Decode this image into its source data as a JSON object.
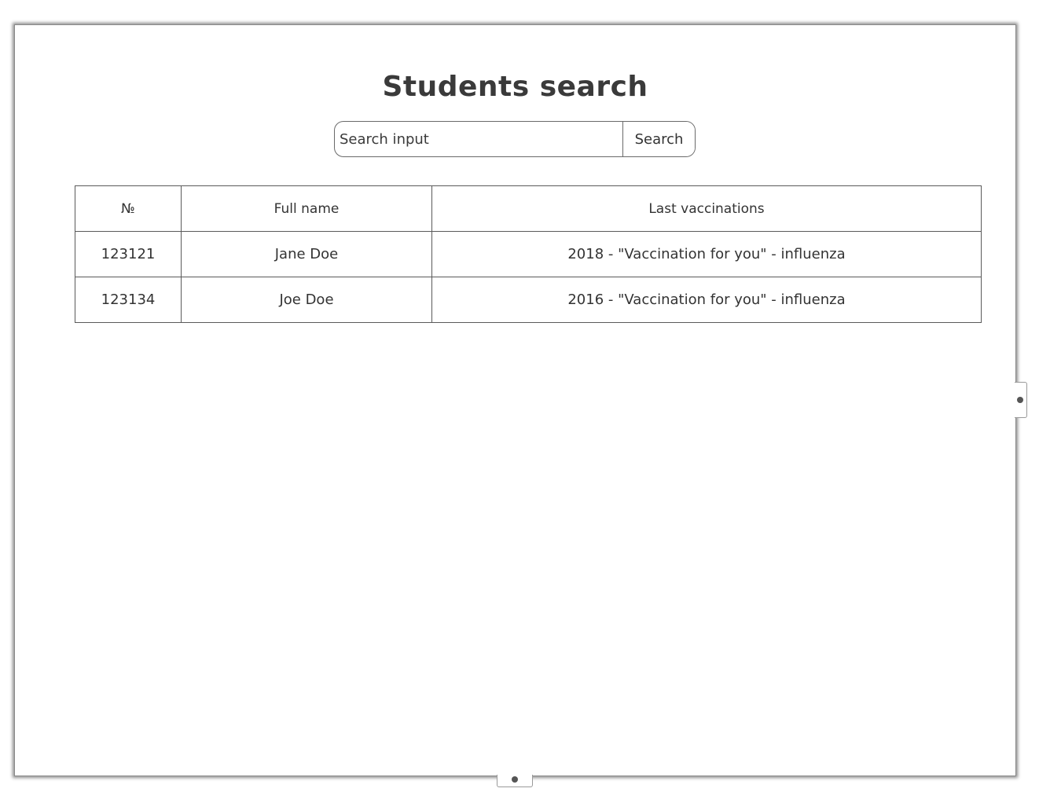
{
  "page": {
    "title": "Students search"
  },
  "search": {
    "placeholder": "Search input",
    "value": "",
    "button_label": "Search"
  },
  "table": {
    "headers": [
      "№",
      "Full name",
      "Last vaccinations"
    ],
    "rows": [
      [
        "123121",
        "Jane Doe",
        "2018 - \"Vaccination for you\" - influenza"
      ],
      [
        "123134",
        "Joe Doe",
        "2016 - \"Vaccination for you\" - influenza"
      ]
    ]
  },
  "handles": {
    "right_icon": "resize-handle-icon",
    "bottom_icon": "resize-handle-icon"
  }
}
